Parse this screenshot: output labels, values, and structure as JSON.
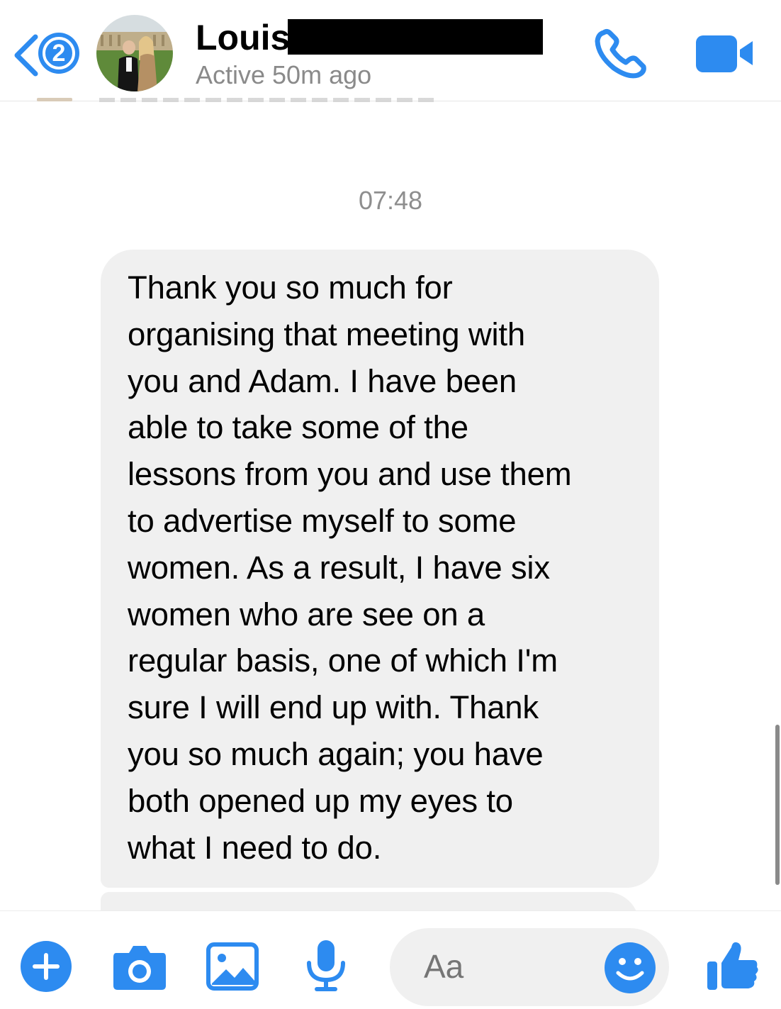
{
  "header": {
    "unread_count": "2",
    "contact_name": "Louis",
    "contact_status": "Active 50m ago",
    "icons": [
      "back-chevron-icon",
      "phone-icon",
      "video-camera-icon"
    ]
  },
  "conversation": {
    "timestamp": "07:48",
    "messages": [
      {
        "sender": "contact",
        "text": "Thank you so much for\norganising that meeting with\nyou and Adam. I have been\nable to take some of the\nlessons from you and use them\nto advertise myself to some\nwomen. As a result, I have six\nwomen who are see on a\nregular basis, one of which I'm\nsure I will end up with. Thank\nyou so much again; you have\nboth opened up my eyes to\nwhat I need to do."
      }
    ]
  },
  "composer": {
    "placeholder": "Aa",
    "icons": [
      "plus-icon",
      "camera-icon",
      "photo-icon",
      "microphone-icon",
      "emoji-icon",
      "thumbs-up-icon"
    ]
  },
  "colors": {
    "accent": "#2d8bf0",
    "bubble": "#f0f0f0",
    "muted_text": "#8a8a8a"
  }
}
